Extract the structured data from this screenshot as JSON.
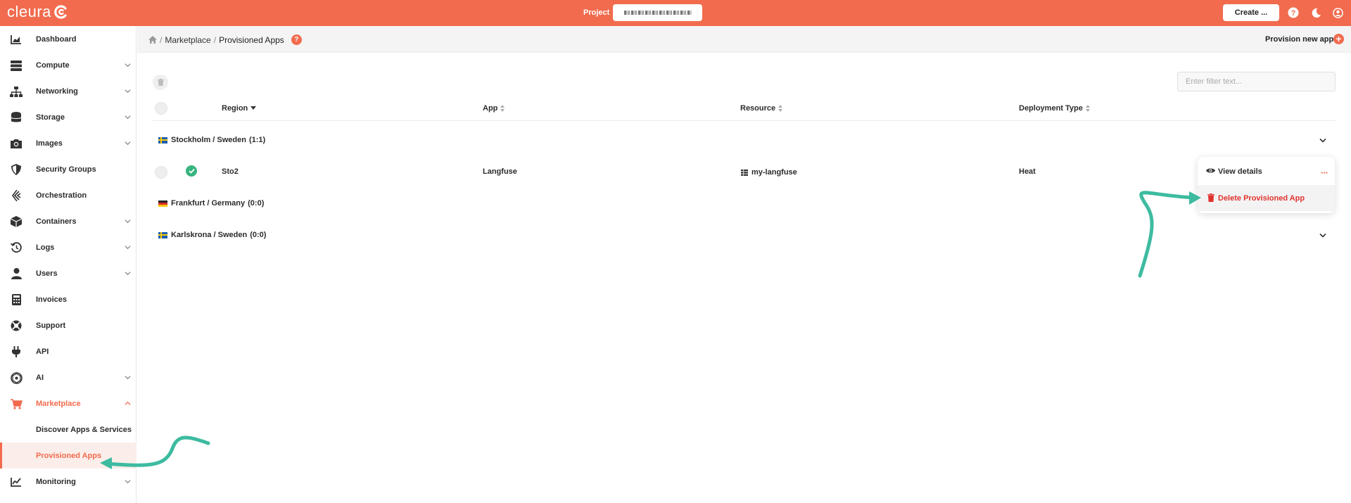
{
  "topbar": {
    "logo_text": "cleura",
    "project_label": "Project",
    "create_label": "Create ...",
    "icons": [
      "help-icon",
      "moon-icon",
      "user-icon"
    ]
  },
  "sidebar": {
    "items": [
      {
        "label": "Dashboard",
        "icon": "chart-area-icon"
      },
      {
        "label": "Compute",
        "icon": "server-icon"
      },
      {
        "label": "Networking",
        "icon": "network-icon"
      },
      {
        "label": "Storage",
        "icon": "database-icon"
      },
      {
        "label": "Images",
        "icon": "camera-icon"
      },
      {
        "label": "Security Groups",
        "icon": "shield-icon"
      },
      {
        "label": "Orchestration",
        "icon": "orchestration-icon"
      },
      {
        "label": "Containers",
        "icon": "cube-icon"
      },
      {
        "label": "Logs",
        "icon": "history-icon"
      },
      {
        "label": "Users",
        "icon": "user-icon"
      },
      {
        "label": "Invoices",
        "icon": "calculator-icon"
      },
      {
        "label": "Support",
        "icon": "lifebuoy-icon"
      },
      {
        "label": "API",
        "icon": "plug-icon"
      },
      {
        "label": "AI",
        "icon": "ai-icon"
      },
      {
        "label": "Marketplace",
        "icon": "cart-icon"
      },
      {
        "label": "Monitoring",
        "icon": "chart-line-icon"
      }
    ],
    "marketplace_sub": [
      {
        "label": "Discover Apps & Services"
      },
      {
        "label": "Provisioned Apps"
      }
    ]
  },
  "header": {
    "breadcrumb": [
      "Marketplace",
      "Provisioned Apps"
    ],
    "help_label": "?",
    "provision_new_label": "Provision new app"
  },
  "table": {
    "filter_placeholder": "Enter filter text...",
    "columns": [
      "Region",
      "App",
      "Resource",
      "Deployment Type"
    ],
    "groups": [
      {
        "label": "Stockholm / Sweden",
        "count": "(1:1)"
      },
      {
        "label": "Frankfurt / Germany",
        "count": "(0:0)"
      },
      {
        "label": "Karlskrona / Sweden",
        "count": "(0:0)"
      }
    ],
    "row": {
      "region": "Sto2",
      "app": "Langfuse",
      "resource": "my-langfuse",
      "deployment_type": "Heat"
    }
  },
  "context_menu": {
    "view_label": "View details",
    "delete_label": "Delete Provisioned App",
    "more_label": "···"
  },
  "colors": {
    "brand": "#f26b4e",
    "success": "#37b480",
    "danger": "#e0322d",
    "annotation": "#3dbba0"
  }
}
